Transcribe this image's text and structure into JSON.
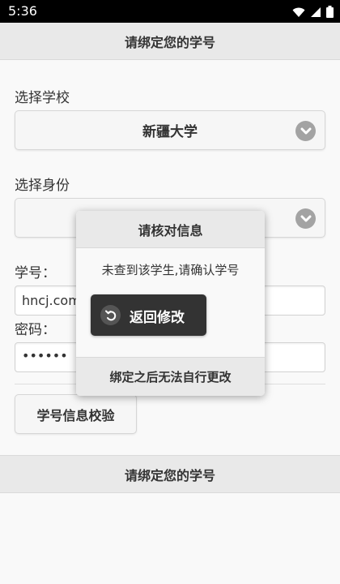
{
  "status_bar": {
    "time": "5:36"
  },
  "header": {
    "title": "请绑定您的学号"
  },
  "form": {
    "school_label": "选择学校",
    "school_value": "新疆大学",
    "identity_label": "选择身份",
    "identity_value": "",
    "student_id_label": "学号：",
    "student_id_value": "hncj.com",
    "password_label": "密码：",
    "password_value": "••••••",
    "verify_button": "学号信息校验"
  },
  "footer": {
    "title": "请绑定您的学号"
  },
  "dialog": {
    "title": "请核对信息",
    "message": "未查到该学生,请确认学号",
    "back_button": "返回修改",
    "footer_note": "绑定之后无法自行更改"
  },
  "icons": {
    "select_chevron": "chevron-down-icon",
    "back": "undo-icon",
    "wifi": "wifi-icon",
    "signal": "signal-icon",
    "battery": "battery-icon"
  }
}
